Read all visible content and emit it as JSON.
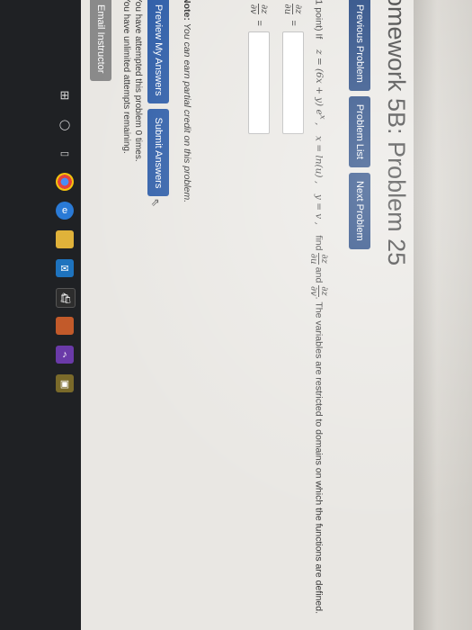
{
  "page": {
    "title": "omework 5B: Problem 25",
    "nav": {
      "previous": "Previous Problem",
      "list": "Problem List",
      "next": "Next Problem"
    },
    "problem": {
      "points": "(1 point) If",
      "eq1": "z = (6x + y) e",
      "eq1_exp": "x",
      "eq2": "x = ln(u) ,",
      "eq3": "y = v ,",
      "find": "find",
      "d_num": "∂z",
      "du": "∂u",
      "dv": "∂v",
      "and": "and",
      "restriction": ". The variables are restricted to domains on which the functions are defined."
    },
    "answers": {
      "eq_sign": "="
    },
    "note_label": "Note:",
    "note_text": " You can earn partial credit on this problem.",
    "preview_button": "Preview My Answers",
    "submit_button": "Submit Answers",
    "attempts_line1": "You have attempted this problem 0 times.",
    "attempts_line2": "You have unlimited attempts remaining.",
    "email_button": "Email Instructor"
  },
  "colors": {
    "nav_button": "#1a3f7c",
    "action_button": "#2f5ea8",
    "email_button": "#8a8a8a",
    "taskbar": "#1f2124"
  },
  "taskbar_icons": [
    "start-icon",
    "search-icon",
    "task-view-icon",
    "chrome-icon",
    "edge-icon",
    "file-explorer-icon",
    "mail-icon",
    "store-icon",
    "photos-icon",
    "music-icon",
    "terminal-icon"
  ]
}
